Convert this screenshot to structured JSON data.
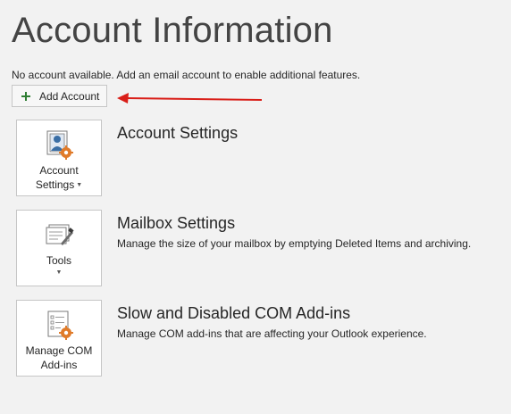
{
  "header": {
    "title": "Account Information"
  },
  "notice": {
    "text": "No account available. Add an email account to enable additional features."
  },
  "add_account": {
    "label": "Add Account",
    "icon": "plus-icon",
    "icon_color": "#2e7d32"
  },
  "annotation": {
    "arrow_color": "#d91e18"
  },
  "sections": [
    {
      "tile_label_line1": "Account",
      "tile_label_line2": "Settings",
      "title": "Account Settings",
      "description": "",
      "icon": "account-settings-icon"
    },
    {
      "tile_label_line1": "Tools",
      "tile_label_line2": "",
      "title": "Mailbox Settings",
      "description": "Manage the size of your mailbox by emptying Deleted Items and archiving.",
      "icon": "mailbox-tools-icon"
    },
    {
      "tile_label_line1": "Manage COM",
      "tile_label_line2": "Add-ins",
      "title": "Slow and Disabled COM Add-ins",
      "description": "Manage COM add-ins that are affecting your Outlook experience.",
      "icon": "com-addins-icon"
    }
  ],
  "colors": {
    "background": "#f2f2f2",
    "gear_accent": "#e07b2a",
    "icon_blue": "#3a6ea5"
  }
}
